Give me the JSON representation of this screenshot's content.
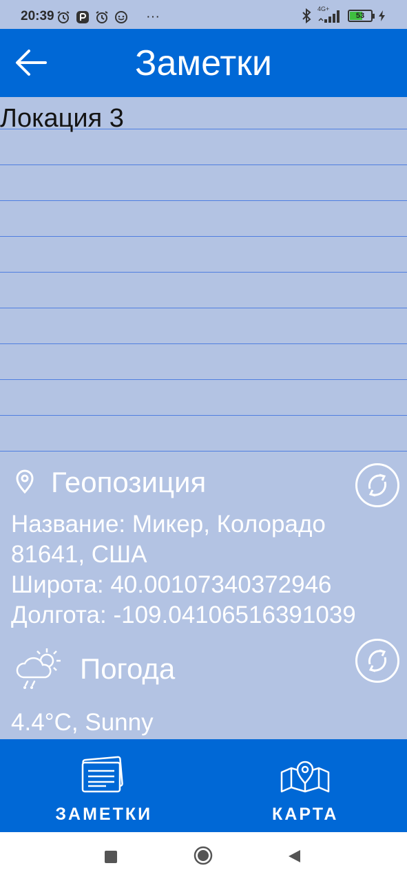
{
  "status_bar": {
    "time": "20:39",
    "dots": "···",
    "network": "4G+",
    "battery": "53",
    "icons": [
      "alarm-icon",
      "app-icon",
      "alarm-icon",
      "face-icon",
      "bluetooth-icon",
      "signal-icon",
      "battery-icon",
      "charging-icon"
    ]
  },
  "app_bar": {
    "title": "Заметки",
    "back_icon": "arrow-left-icon"
  },
  "note": {
    "text": "Локация 3"
  },
  "geo": {
    "icon": "location-pin-icon",
    "title": "Геопозиция",
    "name_line1": "Название: Микер, Колорадо",
    "name_line2": "81641, США",
    "latitude": "Широта: 40.00107340372946",
    "longitude": "Долгота: -109.04106516391039",
    "refresh_icon": "refresh-icon"
  },
  "weather": {
    "icon": "weather-cloud-sun-rain-icon",
    "title": "Погода",
    "value": "4.4°C, Sunny",
    "refresh_icon": "refresh-icon"
  },
  "bottom_nav": {
    "items": [
      {
        "label": "ЗАМЕТКИ",
        "icon": "notes-icon"
      },
      {
        "label": "КАРТА",
        "icon": "map-icon"
      }
    ]
  },
  "colors": {
    "primary": "#0068d6",
    "background": "#b3c3e3",
    "line": "#4f7ee0"
  }
}
